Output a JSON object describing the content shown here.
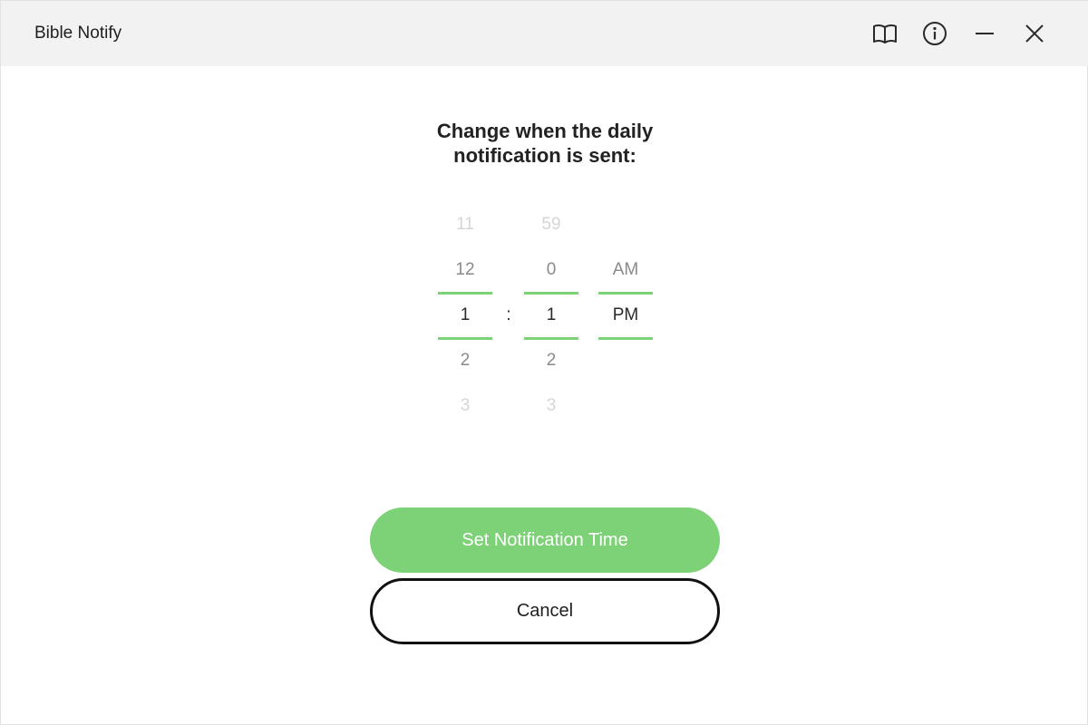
{
  "window": {
    "title": "Bible Notify",
    "controls": {
      "book": "book-icon",
      "info": "info-icon",
      "minimize": "minimize-icon",
      "close": "close-icon"
    }
  },
  "main": {
    "heading_line1": "Change when the daily",
    "heading_line2": "notification is sent:"
  },
  "time_picker": {
    "hour": {
      "prev2": "11",
      "prev1": "12",
      "selected": "1",
      "next1": "2",
      "next2": "3"
    },
    "separator": ":",
    "minute": {
      "prev2": "59",
      "prev1": "0",
      "selected": "1",
      "next1": "2",
      "next2": "3"
    },
    "period": {
      "prev1": "AM",
      "selected": "PM"
    }
  },
  "buttons": {
    "set_label": "Set Notification Time",
    "cancel_label": "Cancel"
  },
  "colors": {
    "accent": "#7dd177",
    "titlebar": "#f2f2f2"
  }
}
